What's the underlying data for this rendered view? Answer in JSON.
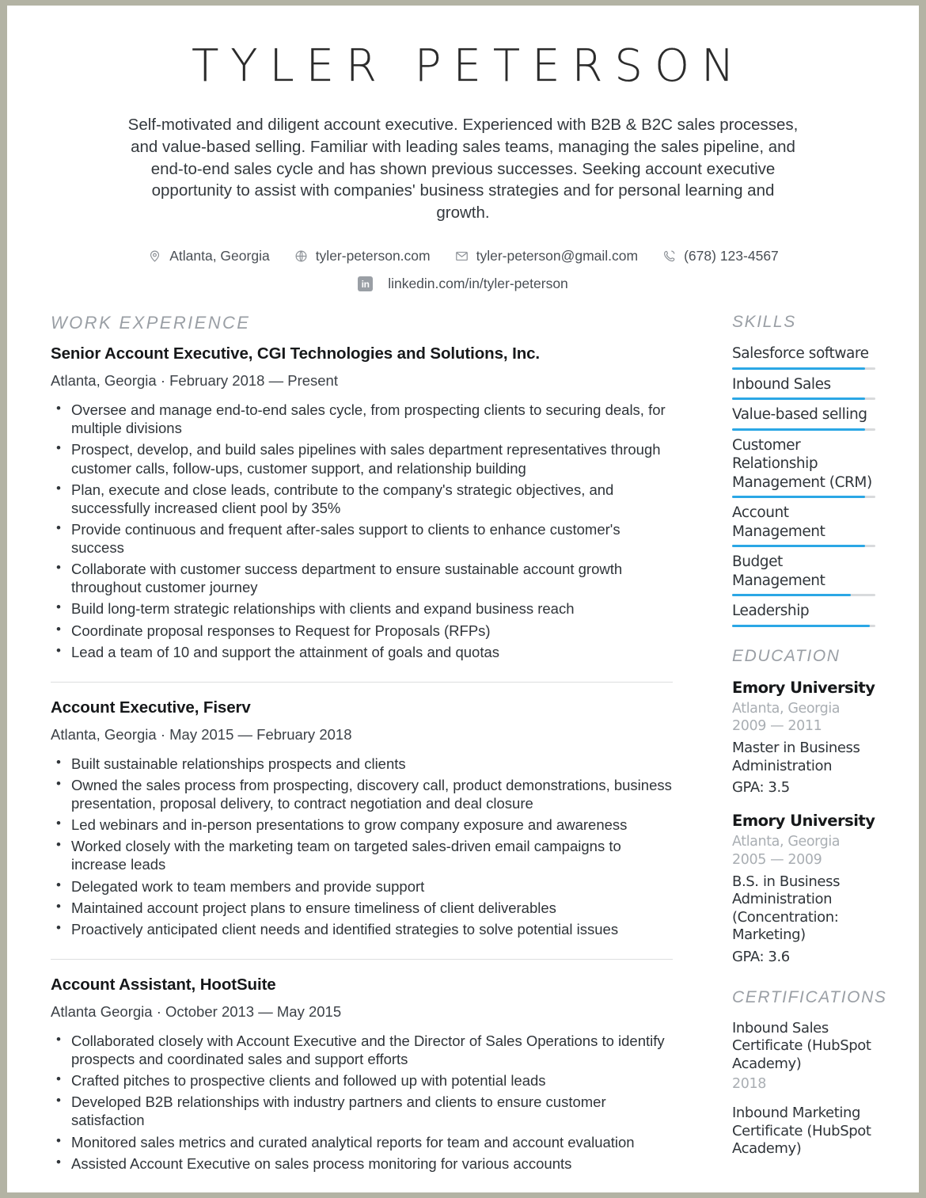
{
  "header": {
    "name": "TYLER PETERSON",
    "summary": "Self-motivated and diligent account executive. Experienced with B2B & B2C sales processes, and value-based selling. Familiar with leading sales teams, managing the sales pipeline, and end-to-end sales cycle and has shown previous successes. Seeking account executive opportunity to assist with companies' business strategies and for personal learning and growth.",
    "contacts": [
      {
        "icon": "location-pin-icon",
        "text": "Atlanta, Georgia"
      },
      {
        "icon": "globe-icon",
        "text": "tyler-peterson.com"
      },
      {
        "icon": "envelope-icon",
        "text": "tyler-peterson@gmail.com"
      },
      {
        "icon": "phone-icon",
        "text": "(678) 123-4567"
      }
    ],
    "linkedin": {
      "icon": "linkedin-icon",
      "badge": "in",
      "text": "linkedin.com/in/tyler-peterson"
    }
  },
  "work": {
    "title": "WORK EXPERIENCE",
    "jobs": [
      {
        "title": "Senior Account Executive, CGI Technologies and Solutions, Inc.",
        "meta": "Atlanta, Georgia · February 2018 — Present",
        "bullets": [
          "Oversee and manage end-to-end sales cycle, from prospecting clients to securing deals, for multiple divisions",
          "Prospect, develop, and build sales pipelines with sales department representatives through customer calls, follow-ups, customer support, and relationship building",
          "Plan, execute and close leads, contribute to the company's strategic objectives, and successfully increased client pool by 35%",
          "Provide continuous and frequent after-sales support to clients to enhance customer's success",
          "Collaborate with customer success department to ensure sustainable account growth throughout customer journey",
          "Build long-term strategic relationships with clients and expand business reach",
          "Coordinate proposal responses to Request for Proposals (RFPs)",
          "Lead a team of 10 and support the attainment of goals and quotas"
        ]
      },
      {
        "title": "Account Executive, Fiserv",
        "meta": "Atlanta, Georgia · May 2015 — February 2018",
        "bullets": [
          "Built sustainable relationships prospects and clients",
          "Owned the sales process from prospecting, discovery call, product demonstrations, business presentation, proposal delivery, to contract negotiation and deal closure",
          "Led webinars and in-person presentations to grow company exposure and awareness",
          "Worked closely with the marketing team on targeted sales-driven email campaigns to increase leads",
          "Delegated work to team members and provide support",
          "Maintained account project plans to ensure timeliness of client deliverables",
          "Proactively anticipated client needs and identified strategies to solve potential issues"
        ]
      },
      {
        "title": "Account Assistant, HootSuite",
        "meta": "Atlanta Georgia · October 2013 — May 2015",
        "bullets": [
          "Collaborated closely with Account Executive and the Director of Sales Operations to identify prospects and coordinated sales and support efforts",
          "Crafted pitches to prospective clients and followed up with potential leads",
          "Developed B2B relationships with industry partners and clients to ensure customer satisfaction",
          "Monitored sales metrics and curated analytical reports for team and account evaluation",
          "Assisted Account Executive on sales process monitoring for various accounts"
        ]
      }
    ]
  },
  "skills": {
    "title": "SKILLS",
    "accent_color": "#2ba7e5",
    "track_color": "#d8dadc",
    "items": [
      {
        "label": "Salesforce software",
        "level": 93
      },
      {
        "label": "Inbound Sales",
        "level": 93
      },
      {
        "label": "Value-based selling",
        "level": 93
      },
      {
        "label": "Customer Relationship Management (CRM)",
        "level": 93
      },
      {
        "label": "Account Management",
        "level": 93
      },
      {
        "label": "Budget Management",
        "level": 83
      },
      {
        "label": "Leadership",
        "level": 96
      }
    ]
  },
  "education": {
    "title": "EDUCATION",
    "entries": [
      {
        "school": "Emory University",
        "location": "Atlanta, Georgia",
        "years": "2009 — 2011",
        "degree": "Master in Business Administration",
        "gpa": "GPA: 3.5"
      },
      {
        "school": "Emory University",
        "location": "Atlanta, Georgia",
        "years": "2005 — 2009",
        "degree": "B.S. in Business Administration (Concentration: Marketing)",
        "gpa": "GPA: 3.6"
      }
    ]
  },
  "certifications": {
    "title": "CERTIFICATIONS",
    "entries": [
      {
        "name": "Inbound Sales Certificate (HubSpot Academy)",
        "year": "2018"
      },
      {
        "name": "Inbound Marketing Certificate (HubSpot Academy)",
        "year": ""
      }
    ]
  }
}
